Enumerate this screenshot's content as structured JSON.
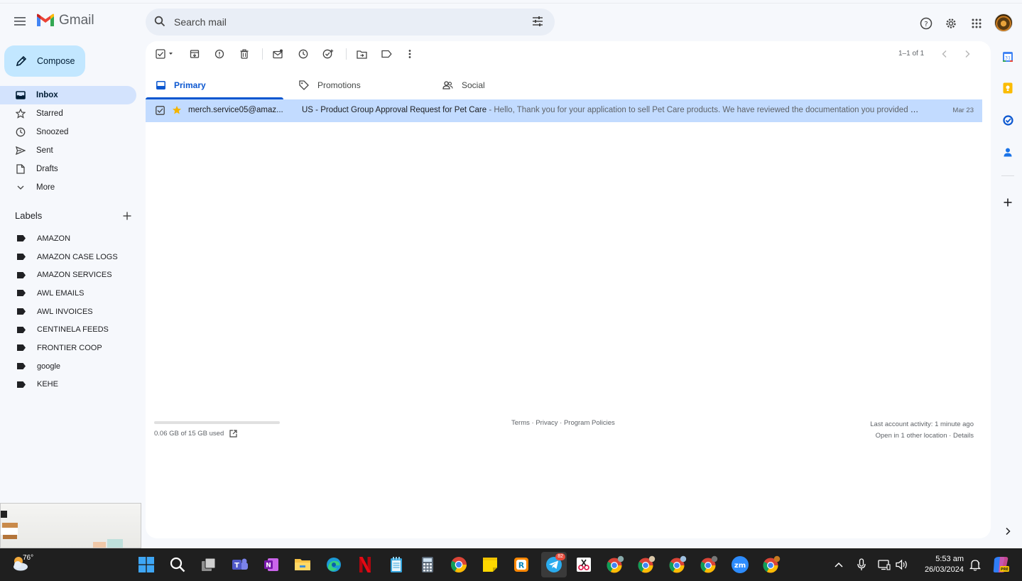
{
  "app": {
    "name": "Gmail"
  },
  "search": {
    "placeholder": "Search mail"
  },
  "compose": {
    "label": "Compose"
  },
  "nav": {
    "items": [
      {
        "label": "Inbox",
        "icon": "inbox-icon",
        "active": true
      },
      {
        "label": "Starred",
        "icon": "star-icon"
      },
      {
        "label": "Snoozed",
        "icon": "clock-icon"
      },
      {
        "label": "Sent",
        "icon": "send-icon"
      },
      {
        "label": "Drafts",
        "icon": "draft-icon"
      },
      {
        "label": "More",
        "icon": "chevron-down-icon"
      }
    ]
  },
  "labels": {
    "title": "Labels",
    "items": [
      "AMAZON",
      "AMAZON CASE LOGS",
      "AMAZON SERVICES",
      "AWL EMAILS",
      "AWL INVOICES",
      "CENTINELA FEEDS",
      "FRONTIER COOP",
      "google",
      "KEHE"
    ]
  },
  "toolbar": {
    "pager": "1–1 of 1"
  },
  "tabs": [
    {
      "label": "Primary",
      "icon": "inbox-icon",
      "active": true
    },
    {
      "label": "Promotions",
      "icon": "tag-icon"
    },
    {
      "label": "Social",
      "icon": "people-icon"
    }
  ],
  "emails": [
    {
      "sender": "merch.service05@amaz...",
      "subject": "US - Product Group Approval Request for Pet Care",
      "snippet": " - Hello, Thank you for your application to sell Pet Care products. We have reviewed the documentation you provided an...",
      "date": "Mar 23",
      "selected": true,
      "starred": true
    }
  ],
  "footer": {
    "storage": "0.06 GB of 15 GB used",
    "storage_used_fraction": 0.004,
    "terms": "Terms",
    "privacy": "Privacy",
    "policies": "Program Policies",
    "sep": " · ",
    "last_activity": "Last account activity: 1 minute ago",
    "open_in": "Open in 1 other location",
    "details": "Details"
  },
  "taskbar": {
    "temperature": "76°",
    "time": "5:53 am",
    "date": "26/03/2024",
    "telegram_badge": "82"
  },
  "colors": {
    "accent": "#0b57d0",
    "compose_bg": "#c2e7ff",
    "nav_active_bg": "#d3e3fd",
    "selected_row_bg": "#c2dbff",
    "star": "#f4b400"
  }
}
